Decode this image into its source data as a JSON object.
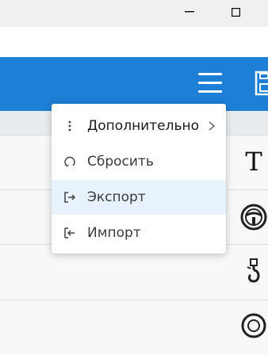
{
  "window": {
    "minimize_glyph": "—",
    "maximize_glyph": "☐"
  },
  "header": {
    "menu_icon": "hamburger-menu-icon",
    "save_icon": "floppy-disk-icon",
    "accent": "#1e7fd6"
  },
  "context_menu": {
    "items": [
      {
        "label": "Дополнительно",
        "icon": "vertical-dots-icon",
        "has_submenu": true
      },
      {
        "label": "Сбросить",
        "icon": "reset-icon"
      },
      {
        "label": "Экспорт",
        "icon": "export-icon",
        "highlighted": true
      },
      {
        "label": "Импорт",
        "icon": "import-icon"
      }
    ]
  },
  "rows": [
    {
      "icon": "text-t-icon",
      "glyph": "T"
    },
    {
      "icon": "steering-wheel-icon"
    },
    {
      "icon": "hook-icon"
    },
    {
      "icon": "wheel-partial-icon"
    }
  ]
}
